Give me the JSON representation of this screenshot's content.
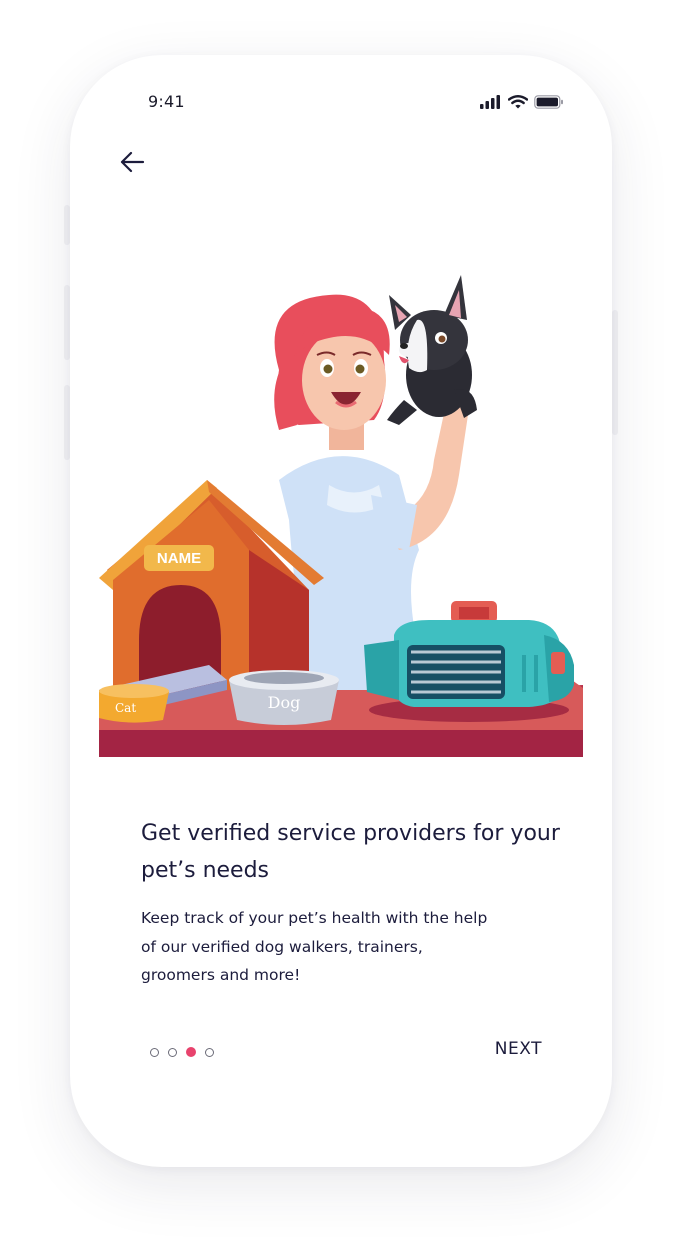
{
  "status_bar": {
    "time": "9:41"
  },
  "onboarding": {
    "title": "Get verified service providers for your pet’s needs",
    "description": "Keep track of your pet’s health with the help of our verified dog walkers, trainers, groomers and more!",
    "page_indicator": {
      "total": 4,
      "active_index": 2
    },
    "next_label": "NEXT"
  },
  "illustration": {
    "doghouse_sign": "NAME",
    "dog_bowl_label": "Dog",
    "cat_bowl_label": "Cat"
  },
  "colors": {
    "text": "#1c1c3c",
    "accent": "#e8436d"
  }
}
